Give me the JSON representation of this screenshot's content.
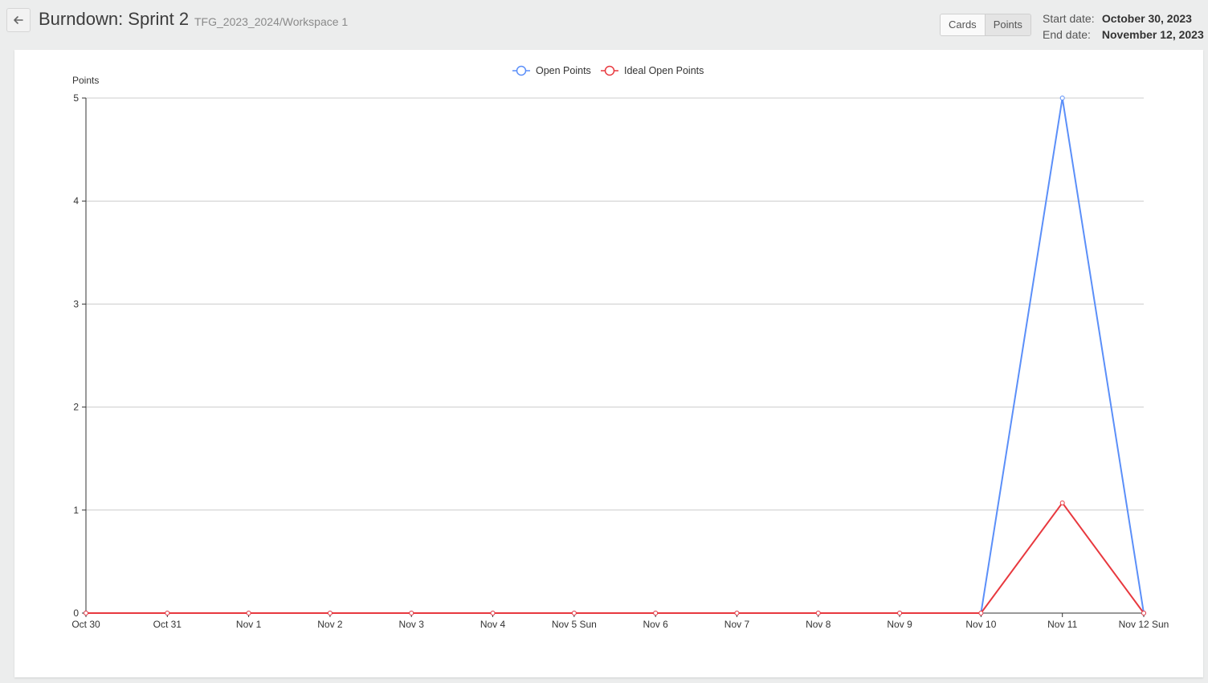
{
  "header": {
    "title": "Burndown: Sprint 2",
    "subtitle": "TFG_2023_2024/Workspace 1",
    "toggle": {
      "cards_label": "Cards",
      "points_label": "Points",
      "active": "Points"
    },
    "start_label": "Start date:",
    "start_value": "October 30, 2023",
    "end_label": "End date:",
    "end_value": "November 12, 2023"
  },
  "colors": {
    "open": "#5b8ff9",
    "ideal": "#e8393f",
    "grid": "#cccccc",
    "axis": "#333333"
  },
  "chart_data": {
    "type": "line",
    "ylabel": "Points",
    "ylim": [
      0,
      5
    ],
    "yticks": [
      "0",
      "1",
      "2",
      "3",
      "4",
      "5"
    ],
    "categories": [
      "Oct 30",
      "Oct 31",
      "Nov 1",
      "Nov 2",
      "Nov 3",
      "Nov 4",
      "Nov 5 Sun",
      "Nov 6",
      "Nov 7",
      "Nov 8",
      "Nov 9",
      "Nov 10",
      "Nov 11",
      "Nov 12 Sun"
    ],
    "legend_position": "top-center",
    "grid": true,
    "series": [
      {
        "name": "Open Points",
        "values": [
          0,
          0,
          0,
          0,
          0,
          0,
          0,
          0,
          0,
          0,
          0,
          0,
          5,
          0
        ]
      },
      {
        "name": "Ideal Open Points",
        "values": [
          0,
          0,
          0,
          0,
          0,
          0,
          0,
          0,
          0,
          0,
          0,
          0,
          1.07,
          0
        ]
      }
    ]
  }
}
